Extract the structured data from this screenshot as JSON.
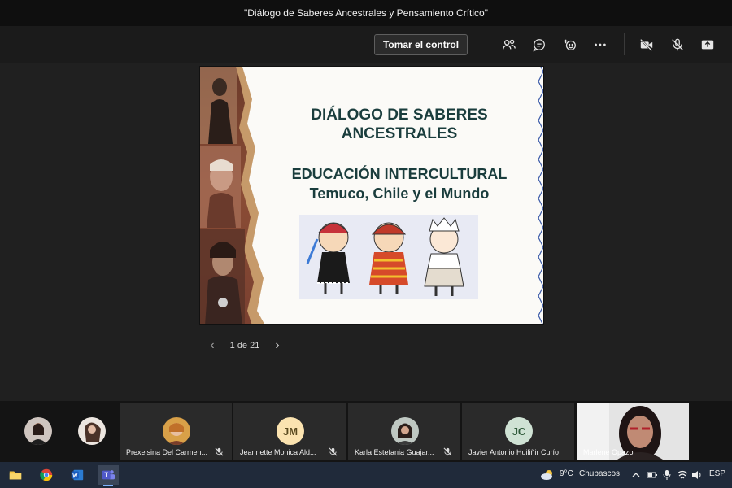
{
  "window": {
    "title": "\"Diálogo de Saberes Ancestrales y Pensamiento Crítico\""
  },
  "toolbar": {
    "take_control_label": "Tomar el control",
    "icons": [
      "people-icon",
      "chat-icon",
      "reactions-icon",
      "more-icon",
      "camera-off-icon",
      "mic-off-icon",
      "share-icon"
    ]
  },
  "slide": {
    "title": "DIÁLOGO DE SABERES ANCESTRALES",
    "subtitle_line1": "EDUCACIÓN INTERCULTURAL",
    "subtitle_line2": "Temuco, Chile y el Mundo",
    "pager": "1 de 21"
  },
  "participants": [
    {
      "name": "Prexelsina Del Carmen...",
      "initials": "",
      "muted": true
    },
    {
      "name": "Jeannette Monica Ald...",
      "initials": "JM",
      "muted": true
    },
    {
      "name": "Karla Estefania Guajar...",
      "initials": "",
      "muted": true
    },
    {
      "name": "Javier Antonio Huiliñir Curío",
      "initials": "JC",
      "muted": false
    },
    {
      "name": "Marlene Opazo",
      "initials": "",
      "muted": false
    }
  ],
  "taskbar": {
    "weather_temp": "9°C",
    "weather_text": "Chubascos",
    "language": "ESP",
    "apps": [
      "file-explorer-icon",
      "chrome-icon",
      "word-icon",
      "teams-icon"
    ]
  },
  "colors": {
    "slide_text": "#1a3d3d",
    "accent": "#80b4ff",
    "background": "#1f1f1f"
  }
}
